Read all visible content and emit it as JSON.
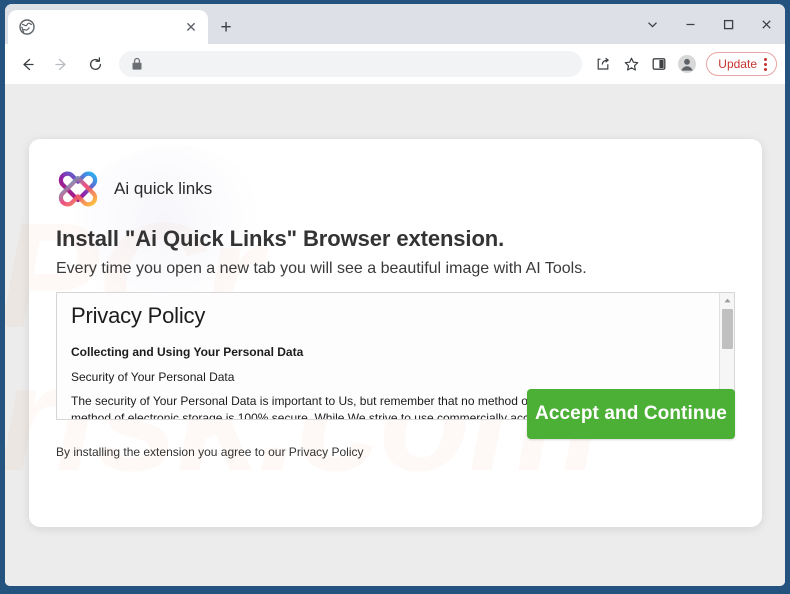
{
  "browser": {
    "tab": {
      "title": "",
      "favicon": "globe-icon",
      "close_label": "✕"
    },
    "new_tab_label": "+",
    "window_controls": {
      "expand_label": "chevron-down-icon",
      "minimize_label": "minimize-icon",
      "maximize_label": "maximize-icon",
      "close_label": "close-icon"
    },
    "toolbar": {
      "back_label": "back-arrow-icon",
      "forward_label": "forward-arrow-icon",
      "reload_label": "reload-icon",
      "omnibox_value": "",
      "omnibox_placeholder": "",
      "lock_icon": "lock-icon",
      "share_icon": "share-icon",
      "bookmark_icon": "star-icon",
      "side_panel_icon": "side-panel-icon",
      "profile_icon": "profile-avatar-icon",
      "update_label": "Update",
      "menu_icon": "three-dot-menu-icon"
    }
  },
  "page": {
    "watermark_line1": "PCr",
    "watermark_line2": "risk.com",
    "extension": {
      "brand_name": "Ai quick links",
      "logo_icon": "ai-quick-links-logo",
      "heading": "Install \"Ai Quick Links\" Browser extension.",
      "subheading": "Every time you open a new tab you will see a beautiful image with AI Tools.",
      "policy": {
        "title": "Privacy Policy",
        "section_heading": "Collecting and Using Your Personal Data",
        "subsection_heading": "Security of Your Personal Data",
        "body": "The security of Your Personal Data is important to Us, but remember that no method of transmission over the Internet or method of electronic storage is 100% secure. While We strive to use commercially acceptable means to protect Your Personal Data, We cannot guarantee its absolute security.",
        "scroll_up_label": "▲",
        "scroll_down_label": "▼"
      },
      "accept_button_label": "Accept and Continue",
      "agreement_text": "By installing the extension you agree to our Privacy Policy"
    }
  },
  "colors": {
    "window_frame": "#25537f",
    "accept_green": "#4caf36",
    "update_red": "#c5362e",
    "page_background": "#ececec",
    "card_background": "#ffffff"
  }
}
